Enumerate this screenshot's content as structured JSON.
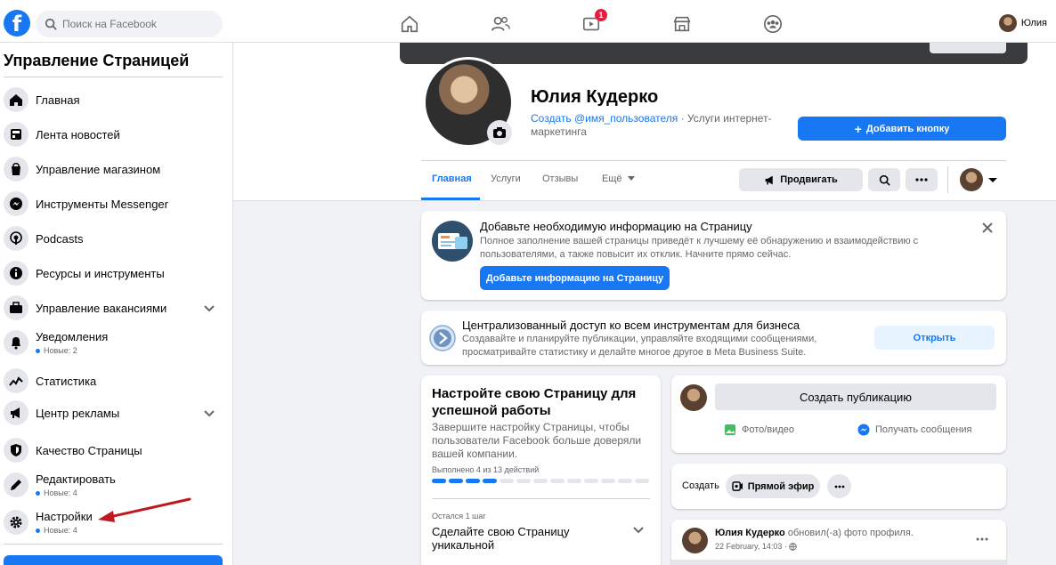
{
  "topbar": {
    "search_placeholder": "Поиск на Facebook",
    "watch_badge": "1",
    "user_name": "Юлия"
  },
  "sidebar": {
    "title": "Управление Страницей",
    "items": [
      {
        "label": "Главная",
        "icon": "home-icon"
      },
      {
        "label": "Лента новостей",
        "icon": "news-feed-icon"
      },
      {
        "label": "Управление магазином",
        "icon": "shopping-bag-icon"
      },
      {
        "label": "Инструменты Messenger",
        "icon": "messenger-icon"
      },
      {
        "label": "Podcasts",
        "icon": "podcast-icon"
      },
      {
        "label": "Ресурсы и инструменты",
        "icon": "info-icon"
      },
      {
        "label": "Управление вакансиями",
        "icon": "briefcase-icon"
      },
      {
        "label": "Уведомления",
        "icon": "bell-icon",
        "sub": "Новые: 2"
      },
      {
        "label": "Статистика",
        "icon": "stats-icon"
      },
      {
        "label": "Центр рекламы",
        "icon": "megaphone-icon"
      },
      {
        "label": "Качество Страницы",
        "icon": "shield-icon"
      },
      {
        "label": "Редактировать",
        "icon": "pencil-icon",
        "sub": "Новые: 4"
      },
      {
        "label": "Настройки",
        "icon": "gear-icon",
        "sub": "Новые: 4"
      }
    ]
  },
  "page": {
    "name": "Юлия Кудерко",
    "username_link": "Создать @имя_пользователя",
    "category": " · Услуги интернет-маркетинга",
    "add_button": "Добавить кнопку",
    "tabs": [
      "Главная",
      "Услуги",
      "Отзывы",
      "Ещё"
    ],
    "promote_button": "Продвигать"
  },
  "info_card": {
    "title": "Добавьте необходимую информацию на Страницу",
    "desc": "Полное заполнение вашей страницы приведёт к лучшему её обнаружению и взаимодействию с пользователями, а также повысит их отклик. Начните прямо сейчас.",
    "button": "Добавьте информацию на Страницу"
  },
  "business_card": {
    "title": "Централизованный доступ ко всем инструментам для бизнеса",
    "desc": "Создавайте и планируйте публикации, управляйте входящими сообщениями, просматривайте статистику и делайте многое другое в Meta Business Suite.",
    "button": "Открыть"
  },
  "setup_card": {
    "title": "Настройте свою Страницу для успешной работы",
    "desc": "Завершите настройку Страницы, чтобы пользователи Facebook больше доверяли вашей компании.",
    "progress_label": "Выполнено 4 из 13 действий",
    "progress_done": 4,
    "progress_total": 13,
    "remaining_label": "Остался 1 шаг",
    "step_title": "Сделайте свою Страницу уникальной"
  },
  "composer": {
    "create_post": "Создать публикацию",
    "photo_video": "Фото/видео",
    "get_messages": "Получать сообщения"
  },
  "create_bar": {
    "label": "Создать",
    "live_button": "Прямой эфир"
  },
  "post": {
    "author": "Юлия Кудерко",
    "action": " обновил(-а) фото профиля.",
    "date": "22 February, 14:03 · "
  },
  "colors": {
    "accent": "#1877f2",
    "arrow": "#c0181f"
  }
}
